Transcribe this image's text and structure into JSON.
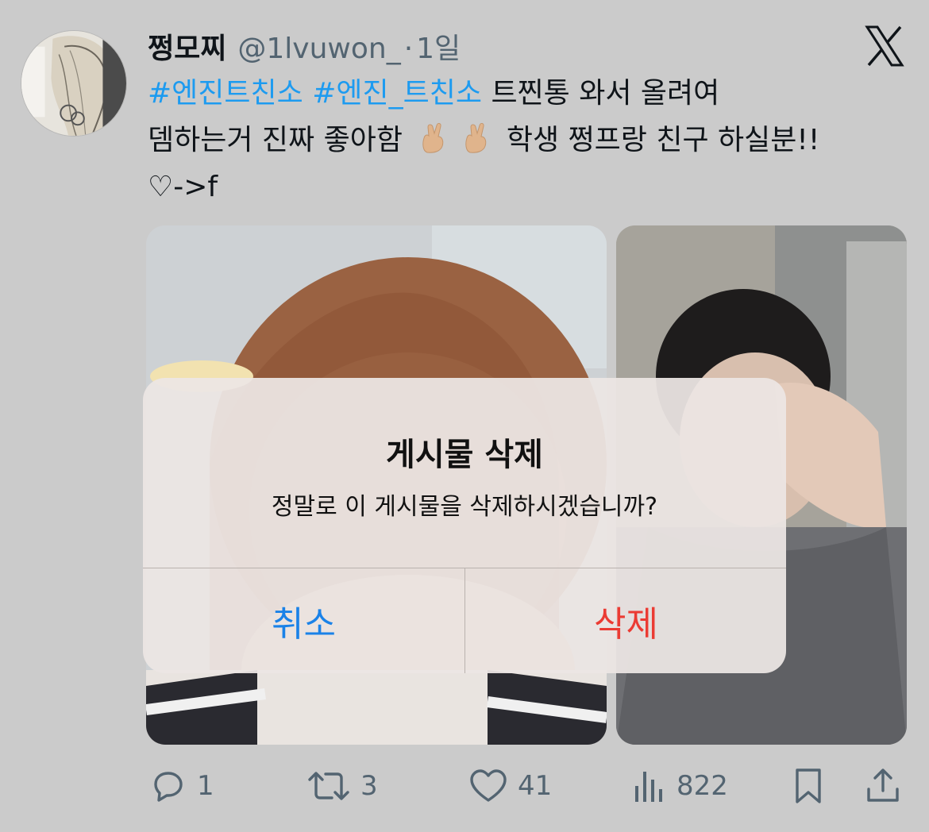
{
  "tweet": {
    "display_name": "쩡모찌",
    "handle": "@1lvuwon_",
    "separator": "·",
    "timestamp": "1일",
    "hashtag_1": "#엔진트친소",
    "hashtag_2": "#엔진_트친소",
    "line1_rest": "트찐통 와서 올려여",
    "line2_start": "뎀하는거 진짜 좋아함",
    "line2_end": "학생 쩡프랑 친구 하실분!!",
    "line3": "♡->f",
    "emoji": "crossed-fingers-emoji"
  },
  "alert": {
    "title": "게시물 삭제",
    "message": "정말로 이 게시물을 삭제하시겠습니까?",
    "cancel_label": "취소",
    "delete_label": "삭제",
    "cancel_color": "#1a82e8",
    "delete_color": "#eb3b33"
  },
  "actions": {
    "replies": "1",
    "retweets": "3",
    "likes": "41",
    "views": "822"
  },
  "colors": {
    "background": "#cbcbcb",
    "hashtag": "#1d9bf0",
    "muted": "#536471"
  }
}
